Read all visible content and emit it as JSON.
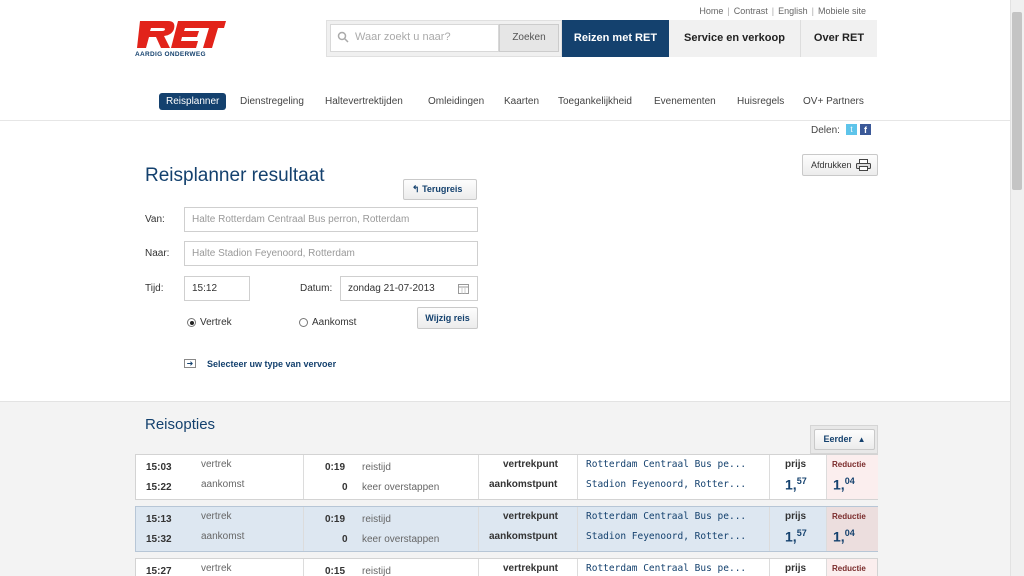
{
  "brand": {
    "logo_text": "RET",
    "tagline": "AARDIG ONDERWEG"
  },
  "util_links": [
    "Home",
    "Contrast",
    "English",
    "Mobiele site"
  ],
  "search": {
    "placeholder": "Waar zoekt u naar?",
    "button": "Zoeken"
  },
  "topnav": [
    "Reizen met RET",
    "Service en verkoop",
    "Over RET"
  ],
  "subnav": [
    "Reisplanner",
    "Dienstregeling",
    "Haltevertrektijden",
    "Omleidingen",
    "Kaarten",
    "Toegankelijkheid",
    "Evenementen",
    "Huisregels",
    "OV+ Partners"
  ],
  "share": {
    "label": "Delen:"
  },
  "print_button": "Afdrukken",
  "planner": {
    "title": "Reisplanner resultaat",
    "return_button": "Terugreis",
    "from_label": "Van:",
    "from_value": "Halte Rotterdam Centraal Bus perron, Rotterdam",
    "to_label": "Naar:",
    "to_value": "Halte Stadion Feyenoord, Rotterdam",
    "time_label": "Tijd:",
    "time_value": "15:12",
    "date_label": "Datum:",
    "date_value": "zondag 21-07-2013",
    "radio_depart": "Vertrek",
    "radio_arrive": "Aankomst",
    "change_button": "Wijzig reis",
    "transport_link": "Selecteer uw type van vervoer"
  },
  "options": {
    "title": "Reisopties",
    "earlier_button": "Eerder",
    "rows": [
      {
        "dep_time": "15:03",
        "arr_time": "15:22",
        "dep_lbl": "vertrek",
        "arr_lbl": "aankomst",
        "duration": "0:19",
        "duration_lbl": "reistijd",
        "transfers": "0",
        "transfers_lbl": "keer overstappen",
        "from_lbl": "vertrekpunt",
        "to_lbl": "aankomstpunt",
        "from": "Rotterdam Centraal Bus pe...",
        "to": "Stadion Feyenoord, Rotter...",
        "price_lbl": "prijs",
        "price_int": "1,",
        "price_dec": "57",
        "red_lbl": "Reductie",
        "red_int": "1,",
        "red_dec": "04"
      },
      {
        "dep_time": "15:13",
        "arr_time": "15:32",
        "dep_lbl": "vertrek",
        "arr_lbl": "aankomst",
        "duration": "0:19",
        "duration_lbl": "reistijd",
        "transfers": "0",
        "transfers_lbl": "keer overstappen",
        "from_lbl": "vertrekpunt",
        "to_lbl": "aankomstpunt",
        "from": "Rotterdam Centraal Bus pe...",
        "to": "Stadion Feyenoord, Rotter...",
        "price_lbl": "prijs",
        "price_int": "1,",
        "price_dec": "57",
        "red_lbl": "Reductie",
        "red_int": "1,",
        "red_dec": "04"
      },
      {
        "dep_time": "15:27",
        "dep_lbl": "vertrek",
        "duration": "0:15",
        "duration_lbl": "reistijd",
        "from_lbl": "vertrekpunt",
        "from": "Rotterdam Centraal Bus pe...",
        "price_lbl": "prijs",
        "red_lbl": "Reductie"
      }
    ]
  },
  "colors": {
    "brand_red": "#e2231a",
    "brand_blue": "#14416e"
  }
}
